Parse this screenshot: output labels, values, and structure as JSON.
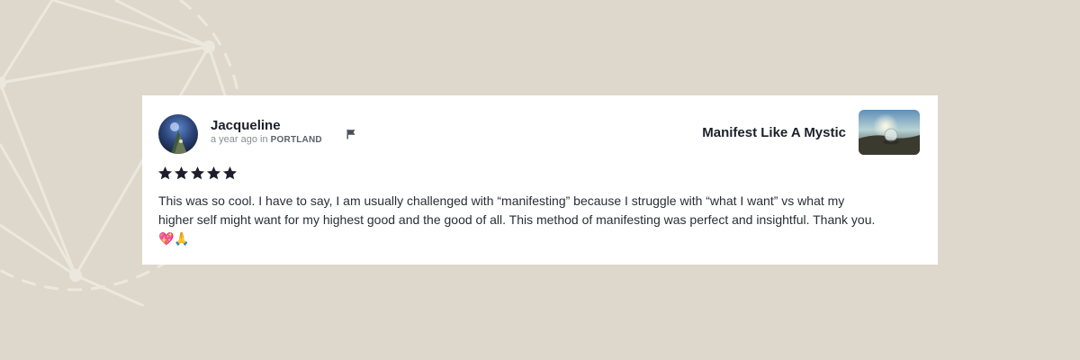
{
  "review": {
    "author": {
      "name": "Jacqueline",
      "time_ago": "a year ago in",
      "location": "PORTLAND"
    },
    "product": {
      "name": "Manifest Like A Mystic"
    },
    "rating": 5,
    "rating_max": 5,
    "body": "This was so cool. I have to say, I am usually challenged with “manifesting” because I struggle with “what I want” vs what my higher self might want for my highest good and the good of all. This method of manifesting was perfect and insightful. Thank you. 💖🙏"
  },
  "icons": {
    "flag": "flag-icon",
    "star": "star-icon"
  },
  "colors": {
    "background": "#ddd8cb",
    "card": "#ffffff",
    "star": "#1c1f2a",
    "text": "#2a2d36"
  }
}
